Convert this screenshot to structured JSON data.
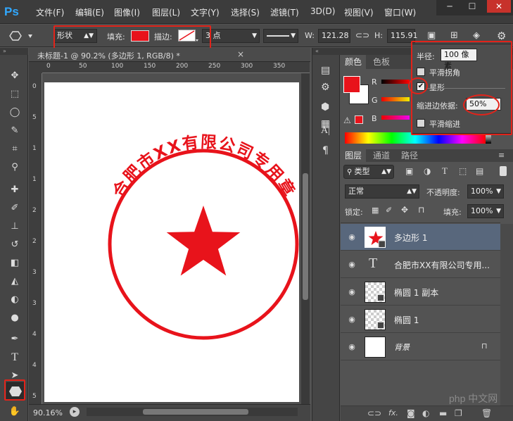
{
  "app": {
    "logo": "Ps"
  },
  "menu": [
    "文件(F)",
    "编辑(E)",
    "图像(I)",
    "图层(L)",
    "文字(Y)",
    "选择(S)",
    "滤镜(T)",
    "3D(D)",
    "视图(V)",
    "窗口(W)"
  ],
  "window_controls": {
    "minimize": "─",
    "maximize": "☐",
    "close": "✕"
  },
  "options": {
    "mode": "形状",
    "fill_label": "填充:",
    "fill_color": "#e8131b",
    "stroke_label": "描边:",
    "stroke_size": "3 点",
    "w_label": "W:",
    "w_value": "121.28",
    "h_label": "H:",
    "h_value": "115.91"
  },
  "doc_tab": "未标题-1 @ 90.2% (多边形 1, RGB/8) *",
  "ruler": {
    "h_ticks": [
      "0",
      "50",
      "100",
      "150",
      "200",
      "250",
      "300",
      "350"
    ],
    "v_ticks": [
      "0",
      "5",
      "1",
      "1",
      "2",
      "2",
      "3",
      "3",
      "4",
      "4",
      "5"
    ]
  },
  "canvas": {
    "stamp_text": "合肥市XX有限公司专用章",
    "stamp_color": "#e8131b"
  },
  "status": {
    "zoom": "90.16%"
  },
  "polygon_popup": {
    "radius_label": "半径:",
    "radius_value": "100 像素",
    "smooth_corners": "平滑拐角",
    "star": "星形",
    "indent_label": "缩进边依据:",
    "indent_value": "50%",
    "smooth_indent": "平滑缩进"
  },
  "color_panel": {
    "tabs": [
      "颜色",
      "色板"
    ],
    "fg_color": "#e8131b",
    "channels": [
      "R",
      "G",
      "B"
    ]
  },
  "layers_panel": {
    "tabs": [
      "图层",
      "通道",
      "路径"
    ],
    "filter_label": "类型",
    "blend_mode": "正常",
    "opacity_label": "不透明度:",
    "opacity_value": "100%",
    "lock_label": "锁定:",
    "fill_label": "填充:",
    "fill_value": "100%",
    "layers": [
      {
        "name": "多边形 1",
        "kind": "shape",
        "selected": true
      },
      {
        "name": "合肥市XX有限公司专用...",
        "kind": "text",
        "selected": false
      },
      {
        "name": "椭圆 1 副本",
        "kind": "shape",
        "selected": false
      },
      {
        "name": "椭圆 1",
        "kind": "shape",
        "selected": false
      },
      {
        "name": "背景",
        "kind": "background",
        "selected": false
      }
    ]
  },
  "watermark": "php 中文网"
}
